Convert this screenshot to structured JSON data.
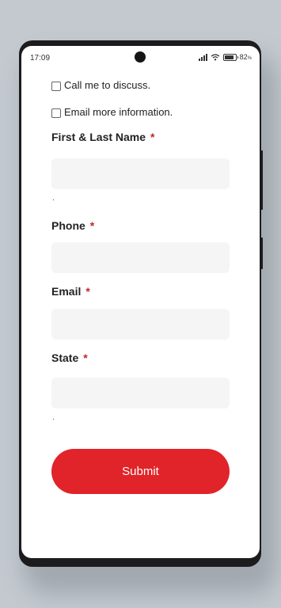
{
  "status_bar": {
    "time": "17:09",
    "battery": "82",
    "battery_unit": "%"
  },
  "form": {
    "checkboxes": [
      {
        "label": "Call me to discuss.",
        "checked": false
      },
      {
        "label": "Email more information.",
        "checked": false
      }
    ],
    "fields": [
      {
        "label": "First & Last Name",
        "required_mark": "*",
        "value": "",
        "note": "."
      },
      {
        "label": "Phone",
        "required_mark": "*",
        "value": ""
      },
      {
        "label": "Email",
        "required_mark": "*",
        "value": ""
      },
      {
        "label": "State",
        "required_mark": "*",
        "value": "",
        "note": "."
      }
    ],
    "submit_label": "Submit"
  },
  "colors": {
    "accent": "#e02429",
    "required": "#c0242b",
    "input_bg": "#f5f5f5"
  }
}
